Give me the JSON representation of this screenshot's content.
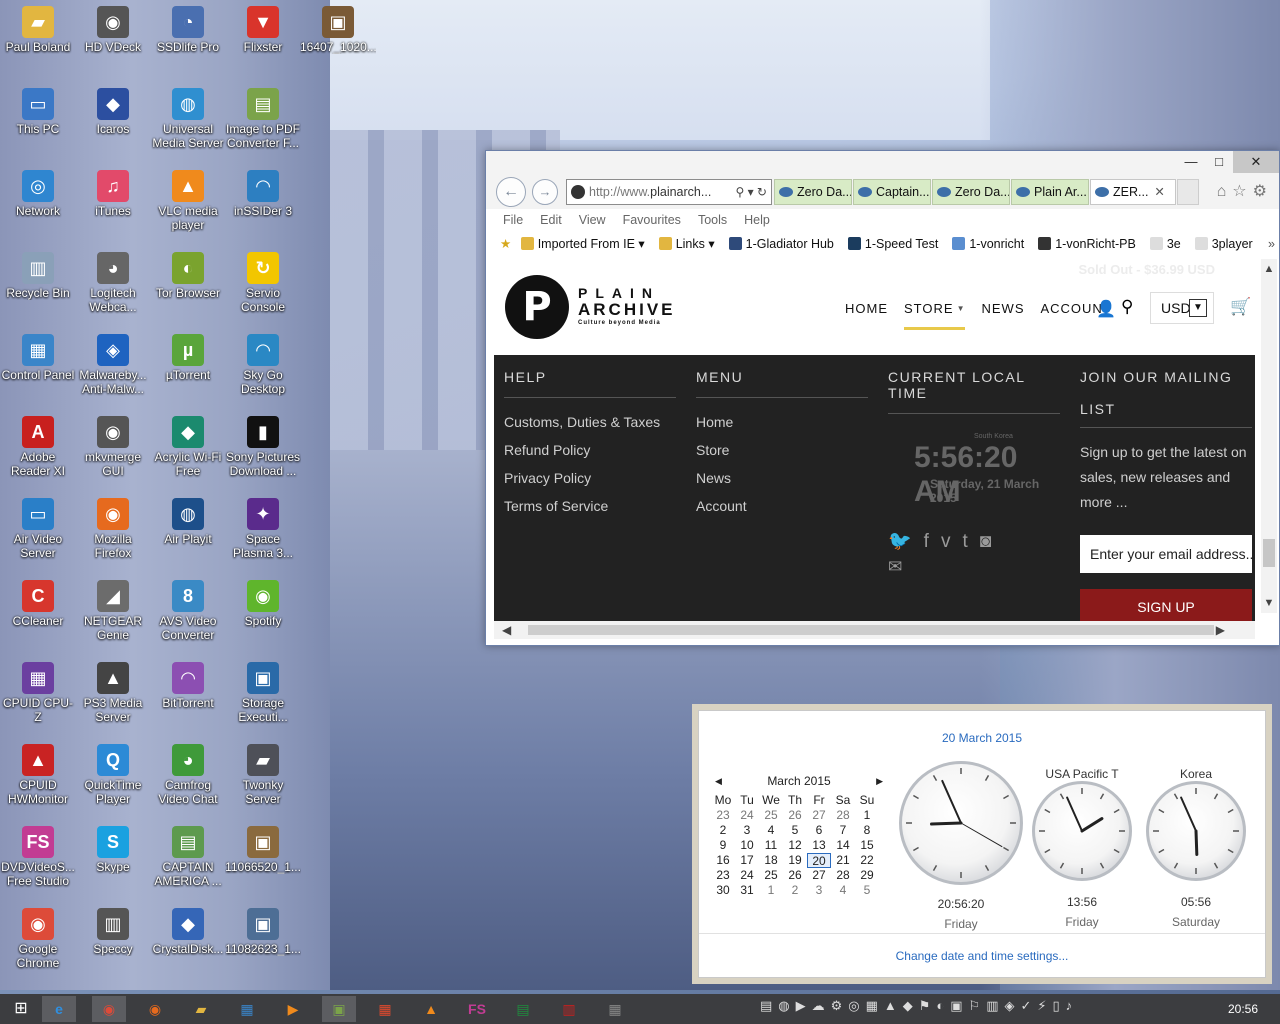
{
  "desktop_icons": [
    {
      "label": "Paul Boland",
      "glyph": "folder-icon",
      "color": "#e2b640",
      "ch": "▰"
    },
    {
      "label": "HD VDeck",
      "glyph": "disc-icon",
      "color": "#555",
      "ch": "◉"
    },
    {
      "label": "SSDlife Pro",
      "glyph": "gauge-icon",
      "color": "#4a6fb0",
      "ch": "◔"
    },
    {
      "label": "Flixster",
      "glyph": "popcorn-icon",
      "color": "#d9342b",
      "ch": "▼"
    },
    {
      "label": "16407_1020...",
      "glyph": "image-icon",
      "color": "#7a5a36",
      "ch": "▣"
    },
    {
      "label": "This PC",
      "glyph": "computer-icon",
      "color": "#3b78c6",
      "ch": "▭"
    },
    {
      "label": "Icaros",
      "glyph": "shield-icon",
      "color": "#2c4fa0",
      "ch": "◆"
    },
    {
      "label": "Universal Media Server",
      "glyph": "media-server-icon",
      "color": "#2f8fd0",
      "ch": "◍"
    },
    {
      "label": "Image to PDF Converter F...",
      "glyph": "pdf-icon",
      "color": "#7ba34a",
      "ch": "▤"
    },
    {
      "label": "Network",
      "glyph": "network-icon",
      "color": "#2f86d0",
      "ch": "◎"
    },
    {
      "label": "iTunes",
      "glyph": "music-icon",
      "color": "#e24a6a",
      "ch": "♫"
    },
    {
      "label": "VLC media player",
      "glyph": "vlc-icon",
      "color": "#f08a1c",
      "ch": "▲"
    },
    {
      "label": "inSSIDer 3",
      "glyph": "wifi-icon",
      "color": "#2d7fc1",
      "ch": "◠"
    },
    {
      "label": "Recycle Bin",
      "glyph": "recycle-bin-icon",
      "color": "#8aa0b8",
      "ch": "▥"
    },
    {
      "label": "Logitech Webca...",
      "glyph": "webcam-icon",
      "color": "#666",
      "ch": "◕"
    },
    {
      "label": "Tor Browser",
      "glyph": "tor-icon",
      "color": "#7aa32e",
      "ch": "◐"
    },
    {
      "label": "Servio Console",
      "glyph": "servio-icon",
      "color": "#f2c600",
      "ch": "↻"
    },
    {
      "label": "Control Panel",
      "glyph": "control-panel-icon",
      "color": "#3a85c9",
      "ch": "▦"
    },
    {
      "label": "Malwareby... Anti-Malw...",
      "glyph": "malwarebytes-icon",
      "color": "#1e63c0",
      "ch": "◈"
    },
    {
      "label": "µTorrent",
      "glyph": "utorrent-icon",
      "color": "#5aa53b",
      "ch": "µ"
    },
    {
      "label": "Sky Go Desktop",
      "glyph": "sky-go-icon",
      "color": "#2a88c4",
      "ch": "◠"
    },
    {
      "label": "Adobe Reader XI",
      "glyph": "adobe-reader-icon",
      "color": "#c8201e",
      "ch": "A"
    },
    {
      "label": "mkvmerge GUI",
      "glyph": "mkvmerge-icon",
      "color": "#555",
      "ch": "◉"
    },
    {
      "label": "Acrylic Wi-Fi Free",
      "glyph": "acrylic-wifi-icon",
      "color": "#1b8a6e",
      "ch": "◆"
    },
    {
      "label": "Sony Pictures Download ...",
      "glyph": "sony-icon",
      "color": "#111",
      "ch": "▮"
    },
    {
      "label": "Air Video Server",
      "glyph": "air-video-icon",
      "color": "#2a7fc8",
      "ch": "▭"
    },
    {
      "label": "Mozilla Firefox",
      "glyph": "firefox-icon",
      "color": "#e66a1e",
      "ch": "◉"
    },
    {
      "label": "Air Playit",
      "glyph": "air-playit-icon",
      "color": "#1d4f8a",
      "ch": "◍"
    },
    {
      "label": "Space Plasma 3...",
      "glyph": "space-plasma-icon",
      "color": "#5a2b8c",
      "ch": "✦"
    },
    {
      "label": "CCleaner",
      "glyph": "ccleaner-icon",
      "color": "#d7362d",
      "ch": "C"
    },
    {
      "label": "NETGEAR Genie",
      "glyph": "netgear-icon",
      "color": "#6c6c6c",
      "ch": "◢"
    },
    {
      "label": "AVS Video Converter",
      "glyph": "avs-icon",
      "color": "#3a8ac5",
      "ch": "8"
    },
    {
      "label": "Spotify",
      "glyph": "spotify-icon",
      "color": "#5fb52c",
      "ch": "◉"
    },
    {
      "label": "CPUID CPU-Z",
      "glyph": "cpuz-icon",
      "color": "#6b3fa0",
      "ch": "▦"
    },
    {
      "label": "PS3 Media Server",
      "glyph": "ps3-icon",
      "color": "#444",
      "ch": "▲"
    },
    {
      "label": "BitTorrent",
      "glyph": "bittorrent-icon",
      "color": "#8c4fb2",
      "ch": "◠"
    },
    {
      "label": "Storage Executi...",
      "glyph": "storage-icon",
      "color": "#2a6aa8",
      "ch": "▣"
    },
    {
      "label": "CPUID HWMonitor",
      "glyph": "hwmonitor-icon",
      "color": "#c92323",
      "ch": "▲"
    },
    {
      "label": "QuickTime Player",
      "glyph": "quicktime-icon",
      "color": "#2c8ad6",
      "ch": "Q"
    },
    {
      "label": "Camfrog Video Chat",
      "glyph": "camfrog-icon",
      "color": "#3f9a3a",
      "ch": "◕"
    },
    {
      "label": "Twonky Server",
      "glyph": "twonky-icon",
      "color": "#4e5058",
      "ch": "▰"
    },
    {
      "label": "DVDVideoS... Free Studio",
      "glyph": "free-studio-icon",
      "color": "#c23c93",
      "ch": "FS"
    },
    {
      "label": "Skype",
      "glyph": "skype-icon",
      "color": "#1aa1e0",
      "ch": "S"
    },
    {
      "label": "CAPTAIN AMERICA ...",
      "glyph": "document-icon",
      "color": "#5d9a4e",
      "ch": "▤"
    },
    {
      "label": "11066520_1...",
      "glyph": "image-icon",
      "color": "#8a6a3e",
      "ch": "▣"
    },
    {
      "label": "Google Chrome",
      "glyph": "chrome-icon",
      "color": "#dd4b39",
      "ch": "◉"
    },
    {
      "label": "Speccy",
      "glyph": "speccy-icon",
      "color": "#555",
      "ch": "▥"
    },
    {
      "label": "CrystalDisk...",
      "glyph": "crystaldisk-icon",
      "color": "#3566b7",
      "ch": "◆"
    },
    {
      "label": "11082623_1...",
      "glyph": "image-icon",
      "color": "#4d6e95",
      "ch": "▣"
    }
  ],
  "ie": {
    "window_controls": {
      "minimize": "—",
      "maximize": "□",
      "close": "✕"
    },
    "back": "←",
    "forward": "→",
    "address_prefix": "http://www.",
    "address_rest": "plainarch...",
    "address_tools": "⚲ ▾ ↻",
    "tabs": [
      {
        "label": "Zero Da...",
        "active": false
      },
      {
        "label": "Captain...",
        "active": false
      },
      {
        "label": "Zero Da...",
        "active": false
      },
      {
        "label": "Plain Ar...",
        "active": false
      },
      {
        "label": "ZER...",
        "active": true,
        "close": "✕"
      }
    ],
    "right_tools": "⌂☆⚙",
    "menu": [
      "File",
      "Edit",
      "View",
      "Favourites",
      "Tools",
      "Help"
    ],
    "favourites": [
      {
        "label": "Imported From IE ▾",
        "icon": "folder-icon",
        "color": "#e2b640"
      },
      {
        "label": "Links ▾",
        "icon": "folder-icon",
        "color": "#e2b640"
      },
      {
        "label": "1-Gladiator Hub",
        "icon": "eye-icon",
        "color": "#2e4a7a"
      },
      {
        "label": "1-Speed Test",
        "icon": "speedtest-icon",
        "color": "#1b3c5e"
      },
      {
        "label": "1-vonricht",
        "icon": "page-icon",
        "color": "#5a8ed0"
      },
      {
        "label": "1-vonRicht-PB",
        "icon": "car-icon",
        "color": "#333"
      },
      {
        "label": "3e",
        "icon": "page-icon",
        "color": "#ddd"
      },
      {
        "label": "3player",
        "icon": "page-icon",
        "color": "#ddd"
      }
    ],
    "fav_more": "»"
  },
  "site": {
    "ghost_price": "Sold Out - $36.99 USD",
    "logo_letter": "P",
    "logo_line1": "PLAIN",
    "logo_line2": "ARCHIVE",
    "logo_line3": "Culture beyond Media",
    "nav": [
      {
        "label": "HOME",
        "active": false
      },
      {
        "label": "STORE",
        "active": true,
        "chevron": "▼"
      },
      {
        "label": "NEWS",
        "active": false
      },
      {
        "label": "ACCOUNT",
        "active": false
      }
    ],
    "currency": "USD",
    "currency_dd": "▼",
    "footer": {
      "help_title": "HELP",
      "help_links": [
        "Customs, Duties & Taxes",
        "Refund Policy",
        "Privacy Policy",
        "Terms of Service"
      ],
      "menu_title": "MENU",
      "menu_links": [
        "Home",
        "Store",
        "News",
        "Account"
      ],
      "time_title": "CURRENT LOCAL TIME",
      "time_zone": "South Korea",
      "time_value": "5:56:20 AM",
      "time_date": "Saturday, 21 March 2015",
      "join_title": "JOIN OUR MAILING LIST",
      "join_desc": "Sign up to get the latest on sales, new releases and more ...",
      "email_placeholder": "Enter your email address..",
      "signup_label": "SIGN UP"
    }
  },
  "clock_flyout": {
    "date_header": "20 March 2015",
    "month_label": "March 2015",
    "prev": "◀",
    "next": "▶",
    "weekdays": [
      "Mo",
      "Tu",
      "We",
      "Th",
      "Fr",
      "Sa",
      "Su"
    ],
    "days": [
      {
        "d": "23",
        "dim": true
      },
      {
        "d": "24",
        "dim": true
      },
      {
        "d": "25",
        "dim": true
      },
      {
        "d": "26",
        "dim": true
      },
      {
        "d": "27",
        "dim": true
      },
      {
        "d": "28",
        "dim": true
      },
      {
        "d": "1"
      },
      {
        "d": "2"
      },
      {
        "d": "3"
      },
      {
        "d": "4"
      },
      {
        "d": "5"
      },
      {
        "d": "6"
      },
      {
        "d": "7"
      },
      {
        "d": "8"
      },
      {
        "d": "9"
      },
      {
        "d": "10"
      },
      {
        "d": "11"
      },
      {
        "d": "12"
      },
      {
        "d": "13"
      },
      {
        "d": "14"
      },
      {
        "d": "15"
      },
      {
        "d": "16"
      },
      {
        "d": "17"
      },
      {
        "d": "18"
      },
      {
        "d": "19"
      },
      {
        "d": "20",
        "today": true
      },
      {
        "d": "21"
      },
      {
        "d": "22"
      },
      {
        "d": "23"
      },
      {
        "d": "24"
      },
      {
        "d": "25"
      },
      {
        "d": "26"
      },
      {
        "d": "27"
      },
      {
        "d": "28"
      },
      {
        "d": "29"
      },
      {
        "d": "30"
      },
      {
        "d": "31"
      },
      {
        "d": "1",
        "dim": true
      },
      {
        "d": "2",
        "dim": true
      },
      {
        "d": "3",
        "dim": true
      },
      {
        "d": "4",
        "dim": true
      },
      {
        "d": "5",
        "dim": true
      }
    ],
    "clocks": [
      {
        "title": "",
        "time": "20:56:20",
        "day": "Friday",
        "hour": 20,
        "minute": 56,
        "second": 20
      },
      {
        "title": "USA Pacific T",
        "time": "13:56",
        "day": "Friday",
        "hour": 13,
        "minute": 56
      },
      {
        "title": "Korea",
        "time": "05:56",
        "day": "Saturday",
        "hour": 5,
        "minute": 56
      }
    ],
    "settings_link": "Change date and time settings..."
  },
  "taskbar": {
    "start": "⊞",
    "apps": [
      {
        "name": "ie-taskbar-icon",
        "ch": "e",
        "color": "#2f8fe0",
        "active": true
      },
      {
        "name": "chrome-taskbar-icon",
        "ch": "◉",
        "color": "#dd4b39",
        "active": true
      },
      {
        "name": "firefox-taskbar-icon",
        "ch": "◉",
        "color": "#e66a1e",
        "active": false
      },
      {
        "name": "explorer-taskbar-icon",
        "ch": "▰",
        "color": "#e2b640",
        "active": false
      },
      {
        "name": "media-taskbar-icon",
        "ch": "▦",
        "color": "#3a85c9",
        "active": false
      },
      {
        "name": "player-taskbar-icon",
        "ch": "▶",
        "color": "#f08a1c",
        "active": false
      },
      {
        "name": "image-taskbar-icon",
        "ch": "▣",
        "color": "#7ba34a",
        "active": true
      },
      {
        "name": "apps-taskbar-icon",
        "ch": "▦",
        "color": "#e24a2e",
        "active": false
      },
      {
        "name": "vlc-taskbar-icon",
        "ch": "▲",
        "color": "#f08a1c",
        "active": false
      },
      {
        "name": "free-studio-taskbar-icon",
        "ch": "FS",
        "color": "#c23c93",
        "active": false
      },
      {
        "name": "excel-taskbar-icon",
        "ch": "▤",
        "color": "#1f8a3e",
        "active": false
      },
      {
        "name": "pdf-taskbar-icon",
        "ch": "▥",
        "color": "#c8201e",
        "active": false
      },
      {
        "name": "calc-taskbar-icon",
        "ch": "▦",
        "color": "#888",
        "active": false
      }
    ],
    "tray": "▤◍▶☁⚙◎▦▲◆⚑◐▣⚐▥◈✓⚡▯♪",
    "time": "20:56"
  }
}
